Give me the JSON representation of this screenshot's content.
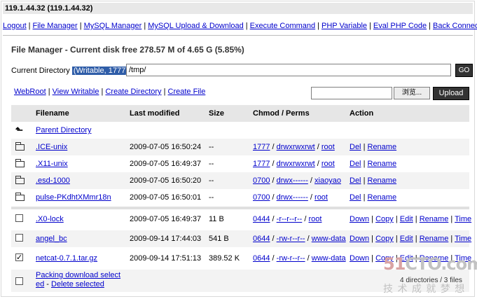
{
  "window": {
    "host": "119.1.44.32 (119.1.44.32)"
  },
  "menu": [
    "Logout",
    "File Manager",
    "MySQL Manager",
    "MySQL Upload & Download",
    "Execute Command",
    "PHP Variable",
    "Eval PHP Code",
    "Back Connect"
  ],
  "file_manager": {
    "title": "File Manager - Current disk free 278.57 M of 4.65 G (5.85%)",
    "current_dir_label": "Current Directory",
    "writable": "(Writable, 1777)",
    "path": "/tmp/",
    "go_label": "GO",
    "actions": [
      "WebRoot",
      "View Writable",
      "Create Directory",
      "Create File"
    ],
    "browse_label": "浏览...",
    "upload_label": "Upload"
  },
  "table": {
    "headers": [
      "Filename",
      "Last modified",
      "Size",
      "Chmod / Perms",
      "Action"
    ],
    "parent": "Parent Directory",
    "dirs": [
      {
        "name": ".ICE-unix",
        "modified": "2009-07-05 16:50:24",
        "size": "--",
        "chmod": "1777",
        "perms": "drwxrwxrwt",
        "owner": "root",
        "actions": [
          "Del",
          "Rename"
        ]
      },
      {
        "name": ".X11-unix",
        "modified": "2009-07-05 16:49:37",
        "size": "--",
        "chmod": "1777",
        "perms": "drwxrwxrwt",
        "owner": "root",
        "actions": [
          "Del",
          "Rename"
        ]
      },
      {
        "name": ".esd-1000",
        "modified": "2009-07-05 16:50:20",
        "size": "--",
        "chmod": "0700",
        "perms": "drwx------",
        "owner": "xiaoyao",
        "actions": [
          "Del",
          "Rename"
        ]
      },
      {
        "name": "pulse-PKdhtXMmr18n",
        "modified": "2009-07-05 16:50:01",
        "size": "--",
        "chmod": "0700",
        "perms": "drwx------",
        "owner": "root",
        "actions": [
          "Del",
          "Rename"
        ]
      }
    ],
    "files": [
      {
        "name": ".X0-lock",
        "modified": "2009-07-05 16:49:37",
        "size": "11 B",
        "chmod": "0444",
        "perms": "-r--r--r--",
        "owner": "root",
        "checked": false,
        "actions": [
          "Down",
          "Copy",
          "Edit",
          "Rename",
          "Time"
        ]
      },
      {
        "name": "angel_bc",
        "modified": "2009-09-14 17:44:03",
        "size": "541 B",
        "chmod": "0644",
        "perms": "-rw-r--r--",
        "owner": "www-data",
        "checked": false,
        "actions": [
          "Down",
          "Copy",
          "Edit",
          "Rename",
          "Time"
        ]
      },
      {
        "name": "netcat-0.7.1.tar.gz",
        "modified": "2009-09-14 17:51:13",
        "size": "389.52 K",
        "chmod": "0644",
        "perms": "-rw-r--r--",
        "owner": "www-data",
        "checked": true,
        "actions": [
          "Down",
          "Copy",
          "Edit",
          "Rename",
          "Time"
        ]
      }
    ],
    "footer": {
      "packing_line1": "Packing download select",
      "packing_line2": "ed",
      "delete_label": "Delete selected",
      "summary": "4 directories / 3 files"
    }
  },
  "watermark": {
    "logo": "51CTO.com",
    "slogan": "技术成就梦想"
  }
}
